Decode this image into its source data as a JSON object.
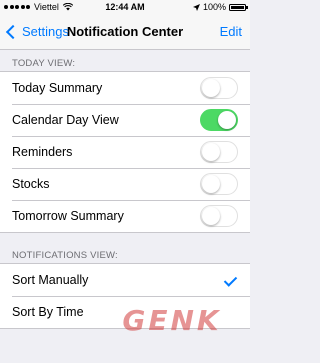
{
  "status_bar": {
    "carrier": "Viettel",
    "time": "12:44 AM",
    "battery": "100%",
    "battery_level": 1.0,
    "icons": [
      "signal-dots-icon",
      "wifi-icon",
      "location-icon",
      "battery-icon"
    ]
  },
  "nav": {
    "back_label": "Settings",
    "title": "Notification Center",
    "edit_label": "Edit"
  },
  "today_view": {
    "header": "TODAY VIEW:",
    "rows": [
      {
        "label": "Today Summary",
        "on": false
      },
      {
        "label": "Calendar Day View",
        "on": true
      },
      {
        "label": "Reminders",
        "on": false
      },
      {
        "label": "Stocks",
        "on": false
      },
      {
        "label": "Tomorrow Summary",
        "on": false
      }
    ]
  },
  "notifications_view": {
    "header": "NOTIFICATIONS VIEW:",
    "rows": [
      {
        "label": "Sort Manually",
        "checked": true
      },
      {
        "label": "Sort By Time",
        "checked": false
      }
    ]
  },
  "watermark": "GENK",
  "colors": {
    "accent": "#007aff",
    "toggle_on": "#4cd964",
    "background": "#efeff4"
  }
}
